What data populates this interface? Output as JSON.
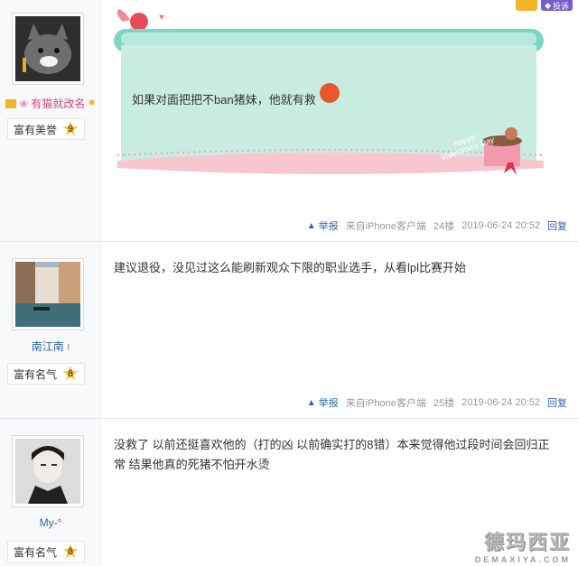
{
  "top_buttons": {
    "report_label": "投诉"
  },
  "posts": [
    {
      "username": "有猫就改名",
      "honor_label": "富有美誉",
      "level": "9",
      "content": "如果对面把把不ban猪妹，他就有救",
      "report_label": "举报",
      "source": "来自iPhone客户端",
      "floor": "24楼",
      "time": "2019-06-24 20:52",
      "reply_label": "回复"
    },
    {
      "username": "南江南",
      "username_suffix": "ℓ",
      "honor_label": "富有名气",
      "level": "8",
      "content": "建议退役，没见过这么能刷新观众下限的职业选手，从看lpl比赛开始",
      "report_label": "举报",
      "source": "来自iPhone客户端",
      "floor": "25楼",
      "time": "2019-06-24 20:52",
      "reply_label": "回复"
    },
    {
      "username": "My-°",
      "honor_label": "富有名气",
      "level": "8",
      "content": "没救了 以前还挺喜欢他的（打的凶 以前确实打的8错）本来觉得他过段时间会回归正常 结果他真的死猪不怕开水烫"
    }
  ],
  "card_script_text": "Happy Valentine's Day",
  "watermark": {
    "main": "德玛西亚",
    "sub": "DEMAXIYA.COM"
  },
  "colors": {
    "link": "#2d64b3",
    "card": "#c9ece2",
    "card_bottom": "#f7c6cf",
    "level_star": "#f6c444"
  }
}
